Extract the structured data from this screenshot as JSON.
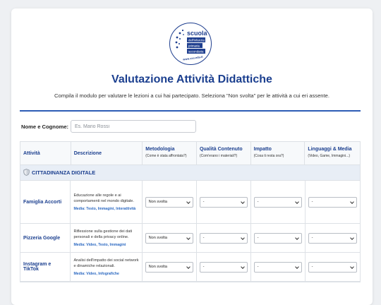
{
  "logo": {
    "top_text": "scuola",
    "lines": [
      "dell'infanzia",
      "primaria",
      "secondaria"
    ],
    "side_text": "www.xxx.edu.it"
  },
  "header": {
    "title": "Valutazione Attività Didattiche",
    "subtitle": "Compila il modulo per valutare le lezioni a cui hai partecipato. Seleziona \"Non svolta\" per le attività a cui eri assente."
  },
  "form": {
    "name_label": "Nome e Cognome:",
    "name_placeholder": "Es. Mario Rossi",
    "name_value": ""
  },
  "table": {
    "columns": [
      {
        "label": "Attività",
        "sub": ""
      },
      {
        "label": "Descrizione",
        "sub": ""
      },
      {
        "label": "Metodologia",
        "sub": "(Come è stata affrontata?)"
      },
      {
        "label": "Qualità Contenuto",
        "sub": "(Com'erano i materiali?)"
      },
      {
        "label": "Impatto",
        "sub": "(Cosa ti resta ora?)"
      },
      {
        "label": "Linguaggi & Media",
        "sub": "(Video, Game, Immagini...)"
      }
    ],
    "section_title": "CITTADINANZA DIGITALE",
    "rows": [
      {
        "name": "Famiglia Accorti",
        "desc": "Educazione alle regole e ai comportamenti nel mondo digitale.",
        "media": "Media: Testo, Immagini, Interattività",
        "metodologia": "Non svolta",
        "qualita": "-",
        "impatto": "-",
        "linguaggi": "-"
      },
      {
        "name": "Pizzeria Google",
        "desc": "Riflessione sulla gestione dei dati personali e della privacy online.",
        "media": "Media: Video, Testo, Immagini",
        "metodologia": "Non svolta",
        "qualita": "-",
        "impatto": "-",
        "linguaggi": "-"
      },
      {
        "name": "Instagram e TikTok",
        "desc": "Analisi dell'impatto dei social network e dinamiche relazionali.",
        "media": "Media: Video, Infografiche",
        "metodologia": "Non svolta",
        "qualita": "-",
        "impatto": "-",
        "linguaggi": "-"
      }
    ]
  },
  "colors": {
    "primary": "#1b3f8f",
    "accent": "#2d5cb5",
    "media_text": "#2d6ac2",
    "section_bg": "#e8eef6"
  }
}
